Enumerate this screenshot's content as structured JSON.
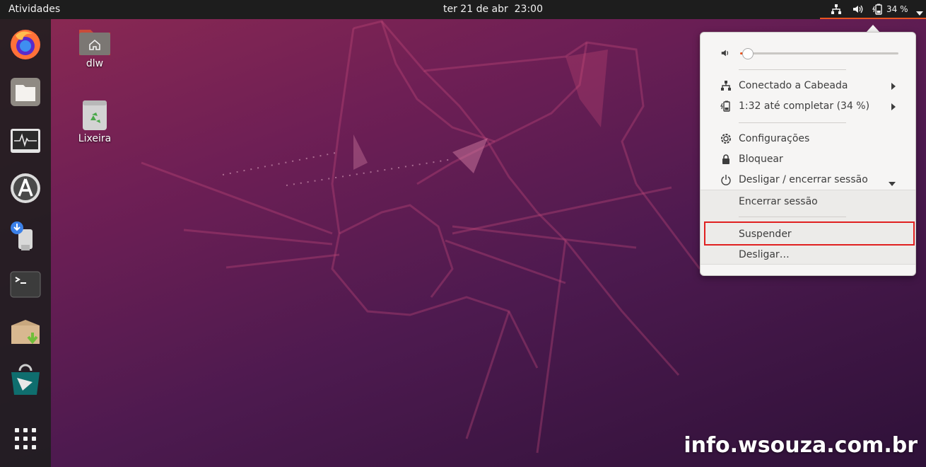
{
  "topbar": {
    "activities": "Atividades",
    "clock": "ter 21 de abr  23:00",
    "battery_percent": "34 %"
  },
  "desktop": {
    "home_label": "dlw",
    "trash_label": "Lixeira"
  },
  "menu": {
    "volume_level": 0.05,
    "network": "Conectado a Cabeada",
    "battery": "1:32 até completar (34 %)",
    "settings": "Configurações",
    "lock": "Bloquear",
    "power_off_logout": "Desligar / encerrar sessão",
    "logout": "Encerrar sessão",
    "suspend": "Suspender",
    "power_off": "Desligar…"
  },
  "watermark": "info.wsouza.com.br",
  "colors": {
    "accent": "#e95420",
    "highlight": "#e02020"
  }
}
